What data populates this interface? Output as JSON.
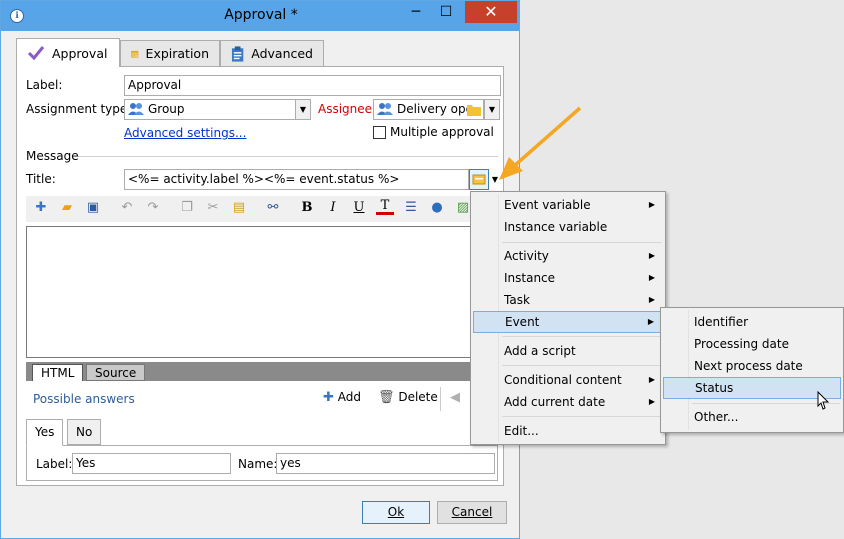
{
  "window": {
    "title": "Approval *",
    "app_icon_glyph": "ℹ",
    "minimize": "─",
    "maximize": "☐",
    "close": "✕"
  },
  "tabs": [
    {
      "label": "Approval",
      "icon": "checkmark-icon"
    },
    {
      "label": "Expiration",
      "icon": "calendar-icon"
    },
    {
      "label": "Advanced",
      "icon": "clipboard-icon"
    }
  ],
  "form": {
    "label_caption": "Label:",
    "label_value": "Approval",
    "assignment_caption": "Assignment type:",
    "assignment_value": "Group",
    "assignee_caption": "Assignee:",
    "assignee_value": "Delivery ope",
    "advanced_settings": "Advanced settings...",
    "multiple_approval": "Multiple approval",
    "message_section": "Message",
    "title_caption": "Title:",
    "title_value": "<%= activity.label %><%= event.status %>"
  },
  "editor": {
    "toolbar": [
      "new",
      "open",
      "save",
      "undo",
      "redo",
      "copy",
      "cut",
      "paste",
      "find",
      "B",
      "I",
      "U",
      "T",
      "list",
      "globe",
      "image"
    ],
    "tabs": [
      "HTML",
      "Source"
    ]
  },
  "answers": {
    "title": "Possible answers",
    "add": "Add",
    "delete": "Delete",
    "tabs": [
      "Yes",
      "No"
    ],
    "label_caption": "Label:",
    "label_value": "Yes",
    "name_caption": "Name:",
    "name_value": "yes"
  },
  "buttons": {
    "ok": "Ok",
    "cancel": "Cancel"
  },
  "menu": {
    "items": [
      {
        "label": "Event variable",
        "submenu": true
      },
      {
        "label": "Instance variable",
        "submenu": false
      },
      {
        "label": "Activity",
        "submenu": true
      },
      {
        "label": "Instance",
        "submenu": true
      },
      {
        "label": "Task",
        "submenu": true
      },
      {
        "label": "Event",
        "submenu": true
      },
      {
        "label": "Add a script",
        "submenu": false
      },
      {
        "label": "Conditional content",
        "submenu": true
      },
      {
        "label": "Add current date",
        "submenu": true
      },
      {
        "label": "Edit...",
        "submenu": false
      }
    ]
  },
  "submenu": {
    "items": [
      "Identifier",
      "Processing date",
      "Next process date",
      "Status",
      "Other..."
    ]
  },
  "colors": {
    "titlebar": "#57a5e8",
    "close": "#c6402c",
    "accent_arrow": "#f5a623",
    "link": "#0033cc",
    "required": "#d20000"
  }
}
